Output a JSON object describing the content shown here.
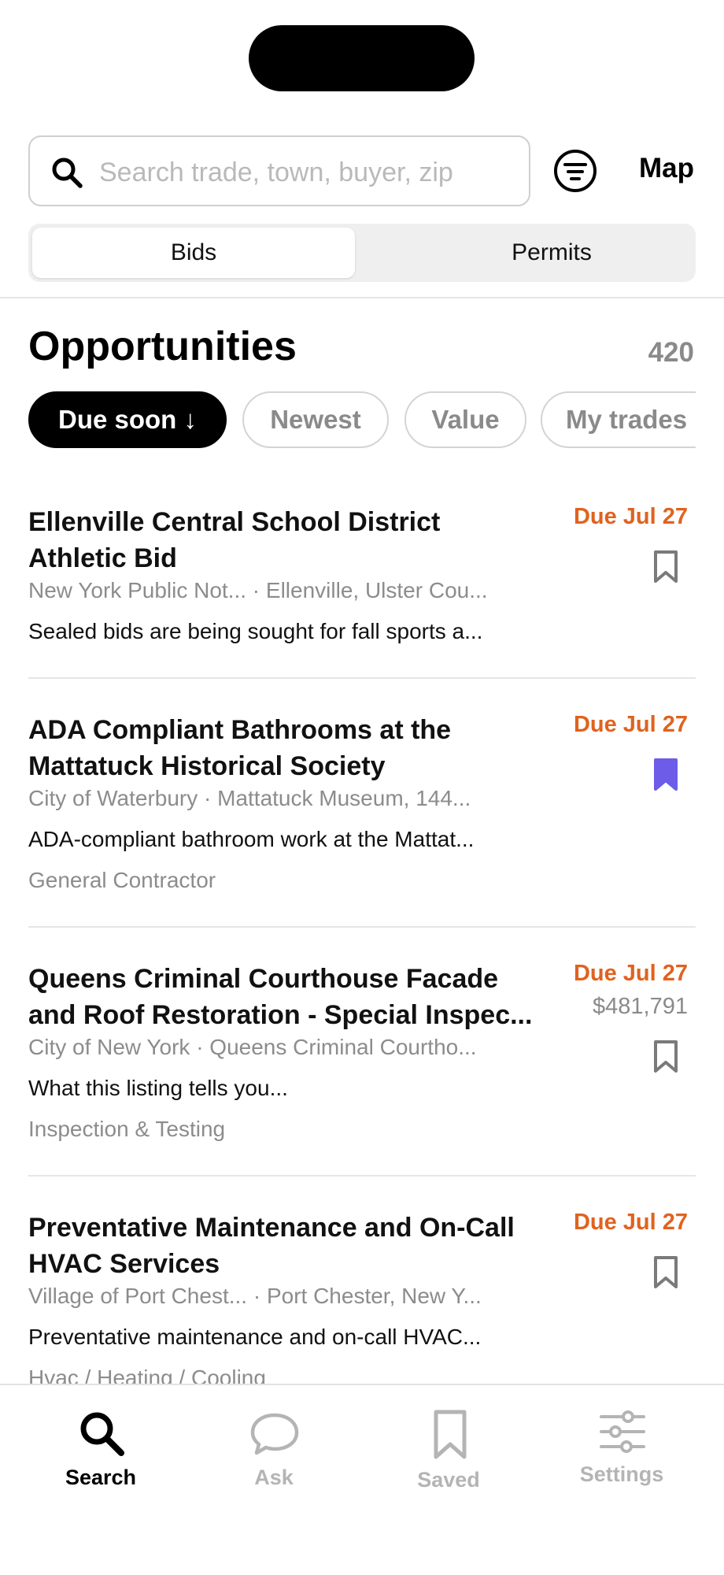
{
  "search": {
    "placeholder": "Search trade, town, buyer, zip",
    "value": ""
  },
  "header": {
    "map_label": "Map"
  },
  "segments": [
    {
      "label": "Bids",
      "active": true
    },
    {
      "label": "Permits",
      "active": false
    }
  ],
  "main": {
    "title": "Opportunities",
    "count": "420",
    "chips": [
      {
        "label": "Due soon ↓",
        "active": true
      },
      {
        "label": "Newest",
        "active": false
      },
      {
        "label": "Value",
        "active": false
      },
      {
        "label": "My trades",
        "active": false
      }
    ]
  },
  "listings": [
    {
      "title": "Ellenville Central School District Athletic Bid",
      "meta": "New York Public Not... · Ellenville, Ulster Cou...",
      "description": "Sealed bids are being sought for fall sports a...",
      "trade": "",
      "due": "Due Jul 27",
      "value": "",
      "saved": false
    },
    {
      "title": "ADA Compliant Bathrooms at the Mattatuck Historical Society",
      "meta": "City of Waterbury · Mattatuck Museum, 144...",
      "description": "ADA-compliant bathroom work at the Mattat...",
      "trade": "General Contractor",
      "due": "Due Jul 27",
      "value": "",
      "saved": true
    },
    {
      "title": "Queens Criminal Courthouse Facade and Roof Restoration - Special Inspec...",
      "meta": "City of New York · Queens Criminal Courtho...",
      "description": "What this listing tells you...",
      "trade": "Inspection & Testing",
      "due": "Due Jul 27",
      "value": "$481,791",
      "saved": false
    },
    {
      "title": "Preventative Maintenance and On-Call HVAC Services",
      "meta": "Village of Port Chest... · Port Chester, New Y...",
      "description": "Preventative maintenance and on-call HVAC...",
      "trade": "Hvac / Heating / Cooling",
      "due": "Due Jul 27",
      "value": "",
      "saved": false
    }
  ],
  "tabbar": {
    "tabs": [
      {
        "label": "Search",
        "icon": "search-icon",
        "active": true
      },
      {
        "label": "Ask",
        "icon": "chat-bubble-icon",
        "active": false
      },
      {
        "label": "Saved",
        "icon": "bookmark-icon",
        "active": false
      },
      {
        "label": "Settings",
        "icon": "sliders-icon",
        "active": false
      }
    ]
  },
  "colors": {
    "accent_due": "#e0621f",
    "bookmark_saved": "#6c5ce7",
    "chip_active_bg": "#000000",
    "muted_text": "#8c8c8c"
  }
}
